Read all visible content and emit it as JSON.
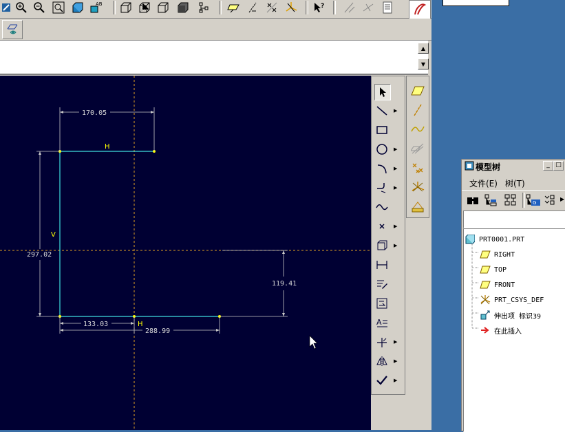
{
  "canvas": {
    "dimensions": {
      "top_width": "170.05",
      "height": "297.02",
      "right_height": "119.41",
      "bottom_short": "133.03",
      "bottom_total": "288.99"
    },
    "constraints": {
      "horizontal": "H",
      "vertical": "V"
    }
  },
  "model_tree": {
    "title": "模型树",
    "menu": [
      "文件(E)",
      "树(T)"
    ],
    "items": [
      {
        "label": "PRT0001.PRT",
        "icon": "part-icon"
      },
      {
        "label": "RIGHT",
        "icon": "datum-plane-icon"
      },
      {
        "label": "TOP",
        "icon": "datum-plane-icon"
      },
      {
        "label": "FRONT",
        "icon": "datum-plane-icon"
      },
      {
        "label": "PRT_CSYS_DEF",
        "icon": "csys-icon"
      },
      {
        "label": "伸出项 标识39",
        "icon": "protrusion-icon"
      },
      {
        "label": "在此插入",
        "icon": "insert-arrow-icon"
      }
    ]
  },
  "colors": {
    "canvas_bg": "#000033",
    "sketch_line": "#40e0e0",
    "dimension": "#d8d8d8",
    "constraint": "#ffff00",
    "datum_axis": "#e0a020",
    "desktop": "#3a6ea5"
  }
}
